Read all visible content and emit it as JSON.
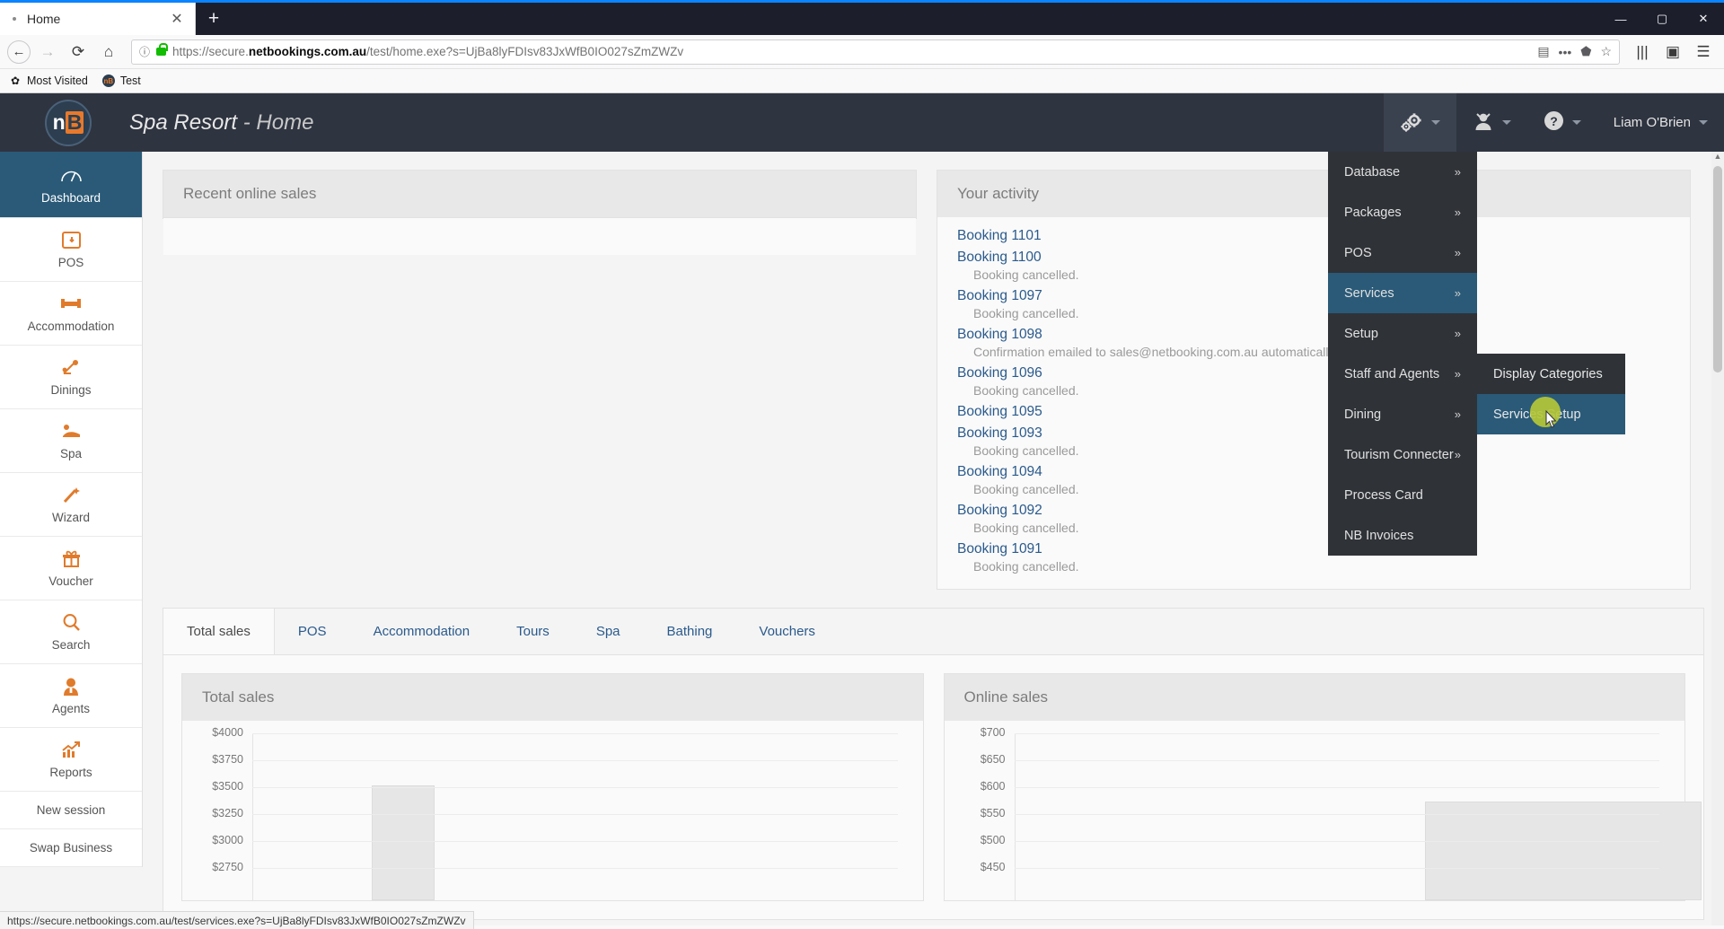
{
  "browser": {
    "tab_title": "Home",
    "tab_close": "✕",
    "new_tab": "+",
    "window_controls": [
      "—",
      "▢",
      "✕"
    ],
    "nav": {
      "back": "←",
      "forward": "→",
      "reload": "⟳",
      "home": "⌂"
    },
    "url": {
      "scheme": "https://",
      "domain_pre": "secure.",
      "domain_bold": "netbookings.com.au",
      "path": "/test/home.exe?s=UjBa8lyFDIsv83JxWfB0IO027sZmZWZv",
      "info_icon": "ⓘ"
    },
    "url_right_icons": [
      "reader-icon",
      "more-icon",
      "pocket-icon",
      "bookmark-star-icon"
    ],
    "nav_right_icons": [
      "library-icon",
      "sidebar-icon",
      "menu-icon"
    ],
    "bookmarks": [
      {
        "label": "Most Visited",
        "icon": "gear-icon"
      },
      {
        "label": "Test",
        "icon": "nb-favicon"
      }
    ],
    "status_url": "https://secure.netbookings.com.au/test/services.exe?s=UjBa8lyFDIsv83JxWfB0IO027sZmZWZv"
  },
  "header": {
    "logo_n": "n",
    "logo_b": "B",
    "brand": "Spa Resort",
    "brand_sub": "- Home",
    "user": "Liam O'Brien",
    "items": [
      {
        "name": "settings-gears",
        "icon": "gears-icon"
      },
      {
        "name": "staff",
        "icon": "person-icon"
      },
      {
        "name": "help",
        "icon": "question-icon"
      }
    ]
  },
  "sidebar": {
    "items": [
      {
        "label": "Dashboard",
        "icon": "speedometer-icon",
        "active": true
      },
      {
        "label": "POS",
        "icon": "pos-icon",
        "active": false
      },
      {
        "label": "Accommodation",
        "icon": "bed-icon",
        "active": false
      },
      {
        "label": "Dinings",
        "icon": "dining-icon",
        "active": false
      },
      {
        "label": "Spa",
        "icon": "spa-icon",
        "active": false
      },
      {
        "label": "Wizard",
        "icon": "wand-icon",
        "active": false
      },
      {
        "label": "Voucher",
        "icon": "gift-icon",
        "active": false
      },
      {
        "label": "Search",
        "icon": "magnifier-icon",
        "active": false
      },
      {
        "label": "Agents",
        "icon": "agent-icon",
        "active": false
      },
      {
        "label": "Reports",
        "icon": "chart-icon",
        "active": false
      }
    ],
    "plain_items": [
      {
        "label": "New session"
      },
      {
        "label": "Swap Business"
      }
    ]
  },
  "menu": {
    "items": [
      {
        "label": "Database",
        "arrow": "»",
        "active": false
      },
      {
        "label": "Packages",
        "arrow": "»",
        "active": false
      },
      {
        "label": "POS",
        "arrow": "»",
        "active": false
      },
      {
        "label": "Services",
        "arrow": "»",
        "active": true
      },
      {
        "label": "Setup",
        "arrow": "»",
        "active": false
      },
      {
        "label": "Staff and Agents",
        "arrow": "»",
        "active": false
      },
      {
        "label": "Dining",
        "arrow": "»",
        "active": false
      },
      {
        "label": "Tourism Connecter",
        "arrow": "»",
        "active": false
      },
      {
        "label": "Process Card",
        "arrow": "",
        "active": false
      },
      {
        "label": "NB Invoices",
        "arrow": "",
        "active": false
      }
    ],
    "submenu": [
      {
        "label": "Display Categories",
        "active": false
      },
      {
        "label": "Services Setup",
        "active": true
      }
    ]
  },
  "panels": {
    "recent_online_sales": {
      "title": "Recent online sales"
    },
    "your_activity": {
      "title": "Your activity",
      "entries": [
        {
          "link": "Booking 1101",
          "note": ""
        },
        {
          "link": "Booking 1100",
          "note": "Booking cancelled."
        },
        {
          "link": "Booking 1097",
          "note": "Booking cancelled."
        },
        {
          "link": "Booking 1098",
          "note": "Confirmation emailed to sales@netbooking.com.au automatically"
        },
        {
          "link": "Booking 1096",
          "note": "Booking cancelled."
        },
        {
          "link": "Booking 1095",
          "note": ""
        },
        {
          "link": "Booking 1093",
          "note": "Booking cancelled."
        },
        {
          "link": "Booking 1094",
          "note": "Booking cancelled."
        },
        {
          "link": "Booking 1092",
          "note": "Booking cancelled."
        },
        {
          "link": "Booking 1091",
          "note": "Booking cancelled."
        }
      ]
    }
  },
  "tabs": [
    {
      "label": "Total sales",
      "active": true
    },
    {
      "label": "POS",
      "active": false
    },
    {
      "label": "Accommodation",
      "active": false
    },
    {
      "label": "Tours",
      "active": false
    },
    {
      "label": "Spa",
      "active": false
    },
    {
      "label": "Bathing",
      "active": false
    },
    {
      "label": "Vouchers",
      "active": false
    }
  ],
  "chart_data": [
    {
      "type": "bar",
      "title": "Total sales",
      "xlabel": "",
      "ylabel": "",
      "categories": [
        "",
        "",
        "",
        "",
        "",
        "",
        ""
      ],
      "values": [
        0,
        3700,
        0,
        0,
        0,
        0,
        0
      ],
      "ticks": [
        "$4000",
        "$3750",
        "$3500",
        "$3250",
        "$3000",
        "$2750"
      ],
      "ylim": [
        2500,
        4000
      ],
      "grid": true,
      "legend": "none"
    },
    {
      "type": "bar",
      "title": "Online sales",
      "xlabel": "",
      "ylabel": "",
      "categories": [
        "",
        "",
        "",
        "",
        "",
        "",
        ""
      ],
      "values": [
        0,
        0,
        0,
        0,
        0,
        600,
        0
      ],
      "ticks": [
        "$700",
        "$650",
        "$600",
        "$550",
        "$500",
        "$450"
      ],
      "ylim": [
        400,
        700
      ],
      "grid": true,
      "legend": "none"
    }
  ],
  "colors": {
    "dark": "#2e3440",
    "accent_blue": "#2a5a78",
    "orange": "#e07b2c",
    "link": "#2a5a8c",
    "cursor_highlight": "#b5c73a"
  }
}
